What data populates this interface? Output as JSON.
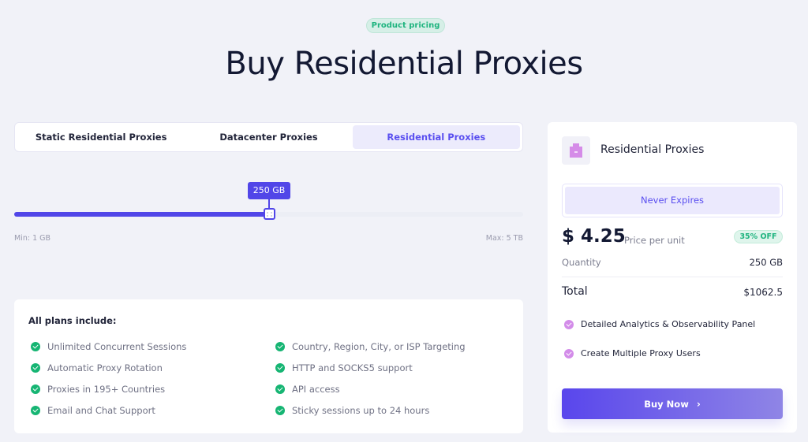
{
  "header": {
    "badge": "Product pricing",
    "title": "Buy Residential Proxies"
  },
  "tabs": [
    {
      "label": "Static Residential Proxies",
      "active": false
    },
    {
      "label": "Datacenter Proxies",
      "active": false
    },
    {
      "label": "Residential Proxies",
      "active": true
    }
  ],
  "slider": {
    "value_label": "250 GB",
    "position_fraction": 0.5,
    "min_label": "Min: 1 GB",
    "max_label": "Max: 5 TB"
  },
  "plans": {
    "title": "All plans include:",
    "items": [
      "Unlimited Concurrent Sessions",
      "Country, Region, City, or ISP Targeting",
      "Automatic Proxy Rotation",
      "HTTP and SOCKS5 support",
      "Proxies in 195+ Countries",
      "API access",
      "Email and Chat Support",
      "Sticky sessions up to 24 hours"
    ]
  },
  "summary": {
    "product_icon": "briefcase-icon",
    "product_name": "Residential Proxies",
    "plan_option": "Never Expires",
    "price": "$ 4.25",
    "price_label": "Price per unit",
    "discount": "35% OFF",
    "quantity_label": "Quantity",
    "quantity_value": "250 GB",
    "total_label": "Total",
    "total_value": "$1062.5",
    "features": [
      "Detailed Analytics & Observability Panel",
      "Create Multiple Proxy Users"
    ],
    "buy_label": "Buy Now",
    "buy_icon": "chevron-right-icon"
  },
  "colors": {
    "accent": "#5146e8",
    "success": "#16b573",
    "feature_check": "#d38ce9",
    "background": "#f1f2f8"
  }
}
